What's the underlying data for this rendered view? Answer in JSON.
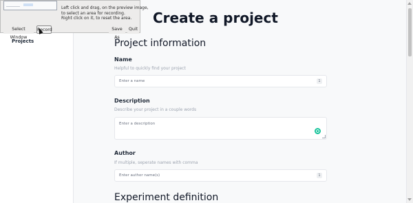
{
  "sidebar": {
    "items": [
      {
        "label": "Projects"
      }
    ]
  },
  "page": {
    "title": "Create a project"
  },
  "sections": {
    "project_information": "Project information",
    "experiment_definition": "Experiment definition"
  },
  "fields": {
    "name": {
      "label": "Name",
      "help": "Helpful to quickly find your project",
      "placeholder": "Enter a name",
      "badge": "1"
    },
    "description": {
      "label": "Description",
      "help": "Describe your project in a couple words",
      "placeholder": "Enter a description"
    },
    "author": {
      "label": "Author",
      "help": "If multiple, seperate names with comma",
      "placeholder": "Enter author name(s)",
      "badge": "1"
    }
  },
  "recorder": {
    "instructions": "Left click and drag, on the preview image,\nto select an area for recording.\nRight click on it, to reset the area.",
    "buttons": {
      "select_window": "Select Window",
      "record": "Record",
      "save_as": "Save As",
      "quit": "Quit"
    }
  },
  "colors": {
    "accent_grammar": "#15c39a",
    "main_bg": "#f8f9fa",
    "recorder_bg": "#edeceb"
  }
}
